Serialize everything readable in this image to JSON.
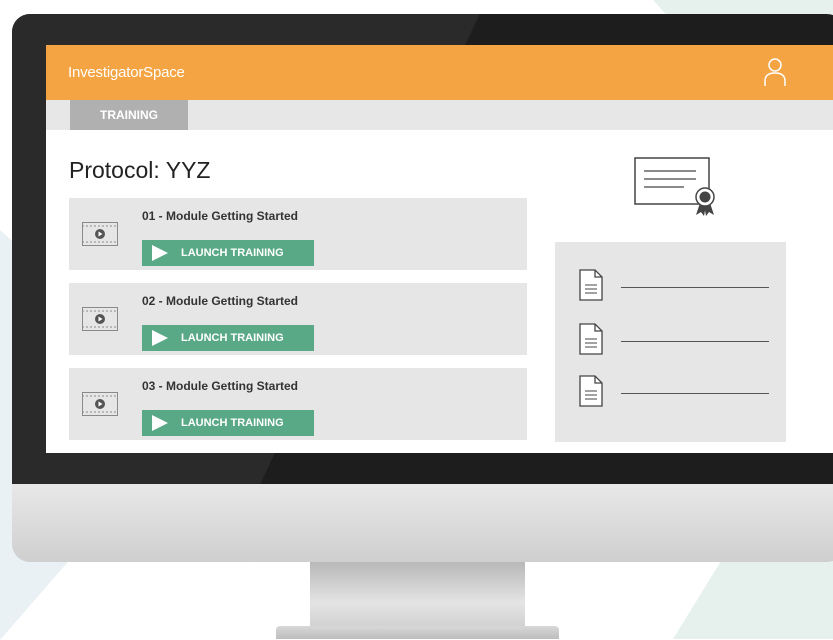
{
  "app": {
    "brand": "InvestigatorSpace",
    "user_icon": "user-icon"
  },
  "tabs": [
    {
      "label": "TRAINING",
      "active": true
    }
  ],
  "main": {
    "protocol_title": "Protocol: YYZ",
    "modules": [
      {
        "title": "01 - Module Getting Started",
        "button_label": "LAUNCH TRAINING",
        "icon": "video-icon"
      },
      {
        "title": "02 - Module Getting Started",
        "button_label": "LAUNCH TRAINING",
        "icon": "video-icon"
      },
      {
        "title": "03 - Module Getting Started",
        "button_label": "LAUNCH TRAINING",
        "icon": "video-icon"
      }
    ]
  },
  "sidebar": {
    "certificate_icon": "certificate-icon",
    "documents": [
      {
        "icon": "document-icon"
      },
      {
        "icon": "document-icon"
      },
      {
        "icon": "document-icon"
      }
    ]
  },
  "colors": {
    "header": "#f4a443",
    "launch_button": "#5aa986",
    "tab": "#b0b0b0",
    "panel": "#e6e6e6"
  }
}
